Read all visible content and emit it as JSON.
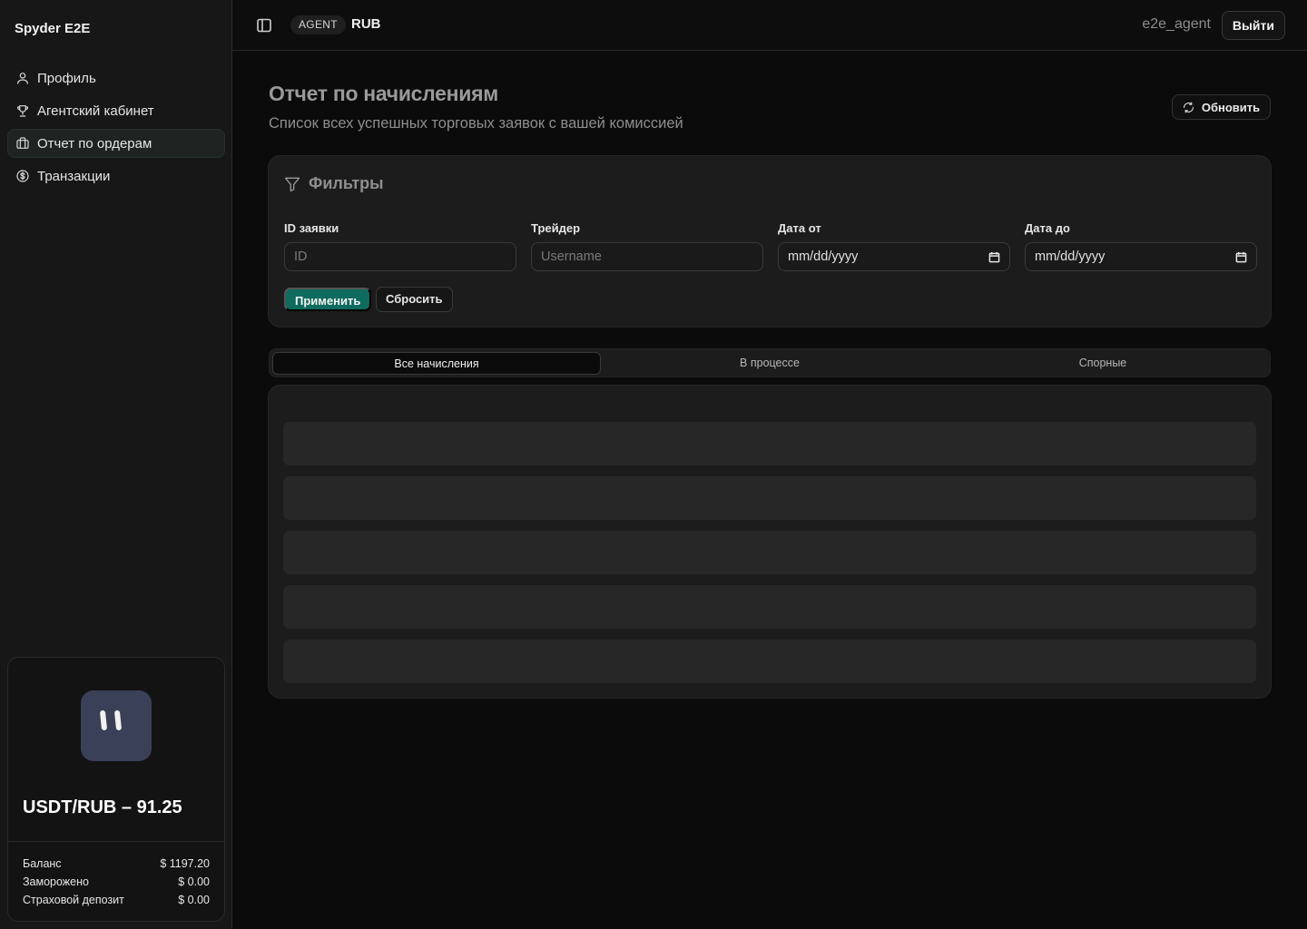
{
  "app": {
    "brand": "Spyder E2E"
  },
  "sidebar": {
    "items": [
      {
        "label": "Профиль",
        "icon": "user-icon"
      },
      {
        "label": "Агентский кабинет",
        "icon": "trophy-icon"
      },
      {
        "label": "Отчет по ордерам",
        "icon": "briefcase-icon",
        "active": true
      },
      {
        "label": "Транзакции",
        "icon": "dollar-circle-icon"
      }
    ]
  },
  "rate_card": {
    "title": "USDT/RUB – 91.25",
    "rows": [
      {
        "label": "Баланс",
        "value": "$ 1197.20"
      },
      {
        "label": "Заморожено",
        "value": "$ 0.00"
      },
      {
        "label": "Страховой депозит",
        "value": "$ 0.00"
      }
    ]
  },
  "header": {
    "role": "AGENT",
    "currency": "RUB",
    "username": "e2e_agent",
    "logout_label": "Выйти"
  },
  "page": {
    "title": "Отчет по начислениям",
    "subtitle": "Список всех успешных торговых заявок с вашей комиссией",
    "refresh_label": "Обновить"
  },
  "filters": {
    "title": "Фильтры",
    "fields": [
      {
        "label": "ID заявки",
        "placeholder": "ID"
      },
      {
        "label": "Трейдер",
        "placeholder": "Username"
      },
      {
        "label": "Дата от",
        "value": "mm/dd/yyyy"
      },
      {
        "label": "Дата до",
        "value": "mm/dd/yyyy"
      }
    ],
    "apply_label": "Применить",
    "reset_label": "Сбросить"
  },
  "tabs": [
    {
      "label": "Все начисления",
      "active": true
    },
    {
      "label": "В процессе"
    },
    {
      "label": "Спорные"
    }
  ],
  "colors": {
    "accent": "#0f6b5e",
    "avatar": "#3a4057"
  }
}
